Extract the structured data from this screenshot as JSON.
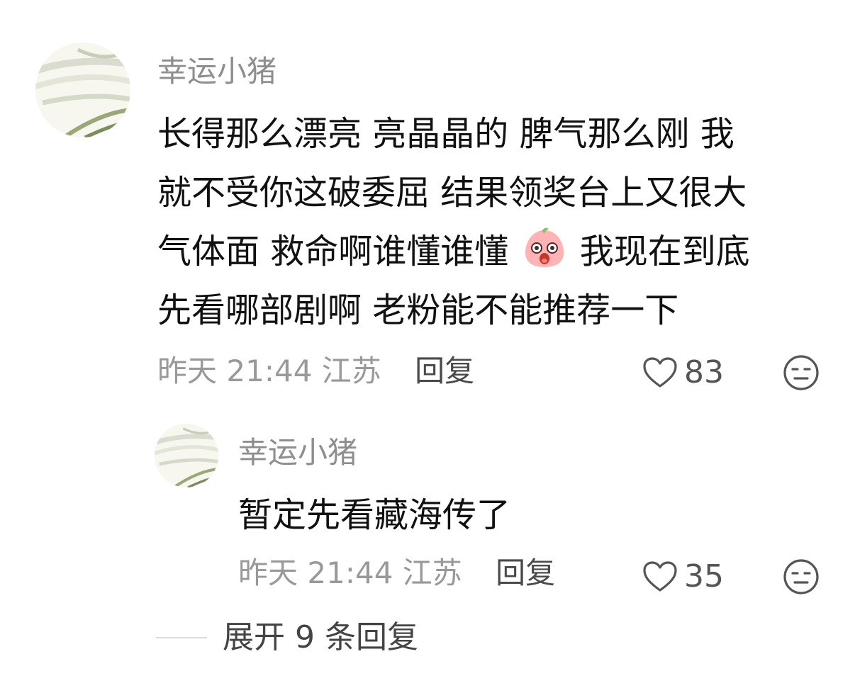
{
  "comment": {
    "username": "幸运小猪",
    "text_line_1": "长得那么漂亮 亮晶晶的 脾气那么刚 我",
    "text_line_2": "就不受你这破委屈 结果领奖台上又很大",
    "text_line_3a": "气体面 救命啊谁懂谁懂",
    "text_line_3b": "我现在到底",
    "text_line_4": "先看哪部剧啊 老粉能不能推荐一下",
    "emoji_icon": "surprised-emoji-icon",
    "date": "昨天",
    "time": "21:44",
    "location": "江苏",
    "reply_label": "回复",
    "likes": "83"
  },
  "reply": {
    "username": "幸运小猪",
    "text": "暂定先看藏海传了",
    "date": "昨天",
    "time": "21:44",
    "location": "江苏",
    "reply_label": "回复",
    "likes": "35"
  },
  "expand": {
    "label": "展开 9 条回复"
  },
  "icons": {
    "like": "heart-outline-icon",
    "dislike": "meh-face-icon"
  },
  "colors": {
    "username": "#8e8e8e",
    "text": "#111111",
    "meta": "#999999",
    "reply_label": "#4a4a4a"
  }
}
